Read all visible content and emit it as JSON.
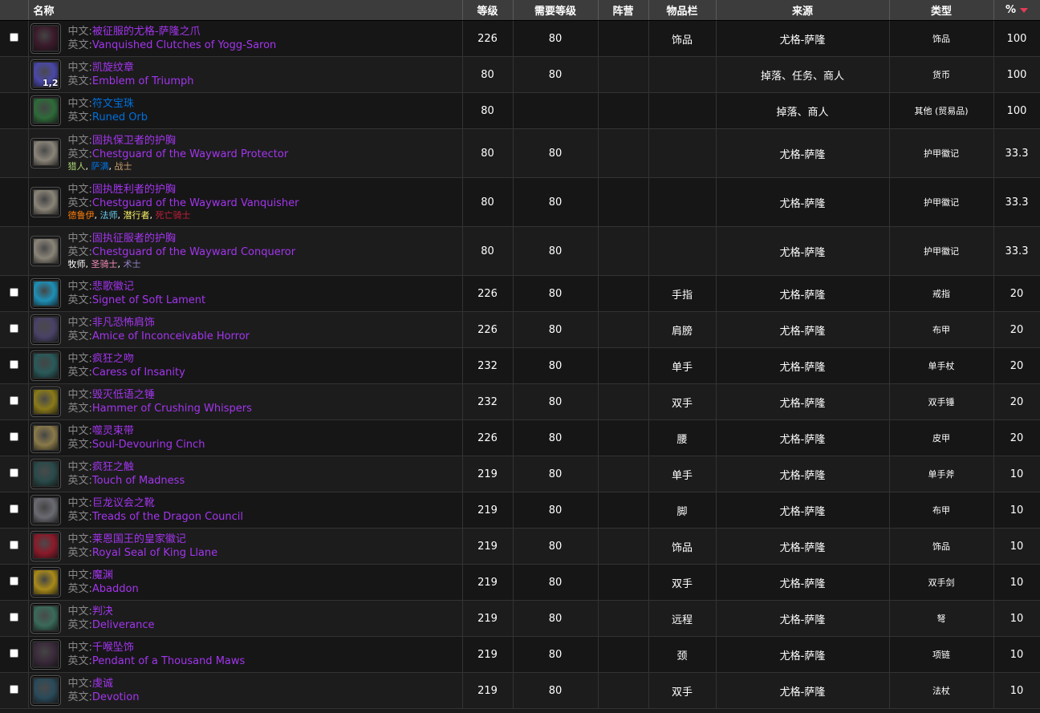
{
  "headers": {
    "name": "名称",
    "level": "等级",
    "req": "需要等级",
    "side": "阵营",
    "slot": "物品栏",
    "source": "来源",
    "type": "类型",
    "pct": "%"
  },
  "label_cn": "中文:",
  "label_en": "英文:",
  "colors": {
    "epic": "#a335ee",
    "rare": "#0070dd",
    "hunter": "#abd473",
    "shaman": "#0070de",
    "warrior": "#c79c6e",
    "druid": "#ff7d0a",
    "mage": "#69ccf0",
    "rogue": "#fff569",
    "dk": "#c41f3b",
    "priest": "#ffffff",
    "paladin": "#f58cba",
    "warlock": "#9482c9"
  },
  "rows": [
    {
      "cb": true,
      "icon": "claw-trinket-icon",
      "bg": "#3a1a2a",
      "cn": "被征服的尤格-萨隆之爪",
      "en": "Vanquished Clutches of Yogg-Saron",
      "q": "epic",
      "lvl": "226",
      "req": "80",
      "slot": "饰品",
      "src": "尤格-萨隆",
      "type": "饰品",
      "pct": "100"
    },
    {
      "cb": false,
      "icon": "emblem-icon",
      "bg": "#4a48a8",
      "count": "1,2",
      "cn": "凯旋纹章",
      "en": "Emblem of Triumph",
      "q": "epic",
      "lvl": "80",
      "req": "80",
      "slot": "",
      "src": "掉落、任务、商人",
      "type": "货币",
      "pct": "100"
    },
    {
      "cb": false,
      "icon": "orb-icon",
      "bg": "#2f6a3a",
      "cn": "符文宝珠",
      "en": "Runed Orb",
      "q": "rare",
      "lvl": "80",
      "req": "",
      "slot": "",
      "src": "掉落、商人",
      "type": "其他 (贸易品)",
      "pct": "100"
    },
    {
      "cb": false,
      "icon": "chest-token-icon",
      "bg": "#8a8478",
      "cn": "固执保卫者的护胸",
      "en": "Chestguard of the Wayward Protector",
      "q": "epic",
      "lvl": "80",
      "req": "80",
      "slot": "",
      "src": "尤格-萨隆",
      "type": "护甲徽记",
      "pct": "33.3",
      "classes": [
        {
          "t": "猎人",
          "c": "hunter"
        },
        {
          "t": "萨满",
          "c": "shaman"
        },
        {
          "t": "战士",
          "c": "warrior"
        }
      ]
    },
    {
      "cb": false,
      "icon": "chest-token-icon",
      "bg": "#8a8478",
      "cn": "固执胜利者的护胸",
      "en": "Chestguard of the Wayward Vanquisher",
      "q": "epic",
      "lvl": "80",
      "req": "80",
      "slot": "",
      "src": "尤格-萨隆",
      "type": "护甲徽记",
      "pct": "33.3",
      "classes": [
        {
          "t": "德鲁伊",
          "c": "druid"
        },
        {
          "t": "法师",
          "c": "mage"
        },
        {
          "t": "潜行者",
          "c": "rogue"
        },
        {
          "t": "死亡骑士",
          "c": "dk"
        }
      ]
    },
    {
      "cb": false,
      "icon": "chest-token-icon",
      "bg": "#8a8478",
      "cn": "固执征服者的护胸",
      "en": "Chestguard of the Wayward Conqueror",
      "q": "epic",
      "lvl": "80",
      "req": "80",
      "slot": "",
      "src": "尤格-萨隆",
      "type": "护甲徽记",
      "pct": "33.3",
      "classes": [
        {
          "t": "牧师",
          "c": "priest"
        },
        {
          "t": "圣骑士",
          "c": "paladin"
        },
        {
          "t": "术士",
          "c": "warlock"
        }
      ]
    },
    {
      "cb": true,
      "icon": "ring-icon",
      "bg": "#1f8fb5",
      "cn": "悲歌徽记",
      "en": "Signet of Soft Lament",
      "q": "epic",
      "lvl": "226",
      "req": "80",
      "slot": "手指",
      "src": "尤格-萨隆",
      "type": "戒指",
      "pct": "20"
    },
    {
      "cb": true,
      "icon": "shoulder-icon",
      "bg": "#4a4266",
      "cn": "非凡恐怖肩饰",
      "en": "Amice of Inconceivable Horror",
      "q": "epic",
      "lvl": "226",
      "req": "80",
      "slot": "肩膀",
      "src": "尤格-萨隆",
      "type": "布甲",
      "pct": "20"
    },
    {
      "cb": true,
      "icon": "wand-icon",
      "bg": "#2a5a5a",
      "cn": "疯狂之吻",
      "en": "Caress of Insanity",
      "q": "epic",
      "lvl": "232",
      "req": "80",
      "slot": "单手",
      "src": "尤格-萨隆",
      "type": "单手杖",
      "pct": "20"
    },
    {
      "cb": true,
      "icon": "hammer-icon",
      "bg": "#8a7a1a",
      "cn": "毁灭低语之锤",
      "en": "Hammer of Crushing Whispers",
      "q": "epic",
      "lvl": "232",
      "req": "80",
      "slot": "双手",
      "src": "尤格-萨隆",
      "type": "双手锤",
      "pct": "20"
    },
    {
      "cb": true,
      "icon": "belt-icon",
      "bg": "#8a7a4a",
      "cn": "噬灵束带",
      "en": "Soul-Devouring Cinch",
      "q": "epic",
      "lvl": "226",
      "req": "80",
      "slot": "腰",
      "src": "尤格-萨隆",
      "type": "皮甲",
      "pct": "20"
    },
    {
      "cb": true,
      "icon": "axe-icon",
      "bg": "#2a4a4a",
      "cn": "疯狂之触",
      "en": "Touch of Madness",
      "q": "epic",
      "lvl": "219",
      "req": "80",
      "slot": "单手",
      "src": "尤格-萨隆",
      "type": "单手斧",
      "pct": "10"
    },
    {
      "cb": true,
      "icon": "boots-icon",
      "bg": "#6a6a72",
      "cn": "巨龙议会之靴",
      "en": "Treads of the Dragon Council",
      "q": "epic",
      "lvl": "219",
      "req": "80",
      "slot": "脚",
      "src": "尤格-萨隆",
      "type": "布甲",
      "pct": "10"
    },
    {
      "cb": true,
      "icon": "seal-icon",
      "bg": "#8a1a2a",
      "cn": "莱恩国王的皇家徽记",
      "en": "Royal Seal of King Llane",
      "q": "epic",
      "lvl": "219",
      "req": "80",
      "slot": "饰品",
      "src": "尤格-萨隆",
      "type": "饰品",
      "pct": "10"
    },
    {
      "cb": true,
      "icon": "sword-icon",
      "bg": "#a88a1a",
      "cn": "魔渊",
      "en": "Abaddon",
      "q": "epic",
      "lvl": "219",
      "req": "80",
      "slot": "双手",
      "src": "尤格-萨隆",
      "type": "双手剑",
      "pct": "10"
    },
    {
      "cb": true,
      "icon": "bow-icon",
      "bg": "#3a6a5a",
      "cn": "判决",
      "en": "Deliverance",
      "q": "epic",
      "lvl": "219",
      "req": "80",
      "slot": "远程",
      "src": "尤格-萨隆",
      "type": "弩",
      "pct": "10"
    },
    {
      "cb": true,
      "icon": "pendant-icon",
      "bg": "#3a2a3a",
      "cn": "千喉坠饰",
      "en": "Pendant of a Thousand Maws",
      "q": "epic",
      "lvl": "219",
      "req": "80",
      "slot": "颈",
      "src": "尤格-萨隆",
      "type": "项链",
      "pct": "10"
    },
    {
      "cb": true,
      "icon": "staff-icon",
      "bg": "#2a4a5a",
      "cn": "虔诚",
      "en": "Devotion",
      "q": "epic",
      "lvl": "219",
      "req": "80",
      "slot": "双手",
      "src": "尤格-萨隆",
      "type": "法杖",
      "pct": "10"
    }
  ]
}
